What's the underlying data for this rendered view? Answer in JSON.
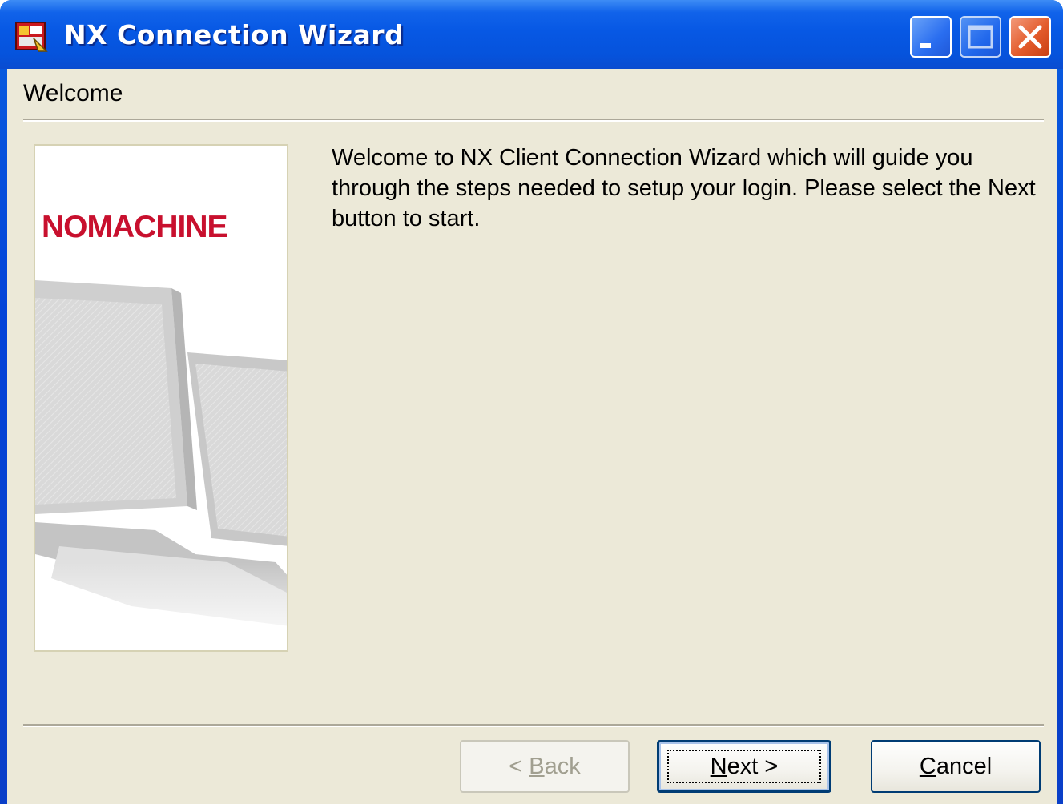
{
  "window": {
    "title": "NX Connection Wizard",
    "app_icon": "nx-app-icon",
    "controls": {
      "minimize_icon": "minimize-icon",
      "maximize_icon": "maximize-icon",
      "close_icon": "close-icon"
    }
  },
  "header": {
    "title": "Welcome"
  },
  "banner": {
    "logo_text": "NOMACHINE",
    "logo_color": "#c8102e"
  },
  "main": {
    "welcome_text": "Welcome to NX Client Connection Wizard which will guide you through the steps needed to setup your login. Please select the Next button to start."
  },
  "buttons": {
    "back": {
      "prefix": "< ",
      "mnemonic": "B",
      "rest": "ack",
      "enabled": false
    },
    "next": {
      "mnemonic": "N",
      "rest": "ext >",
      "default": true
    },
    "cancel": {
      "mnemonic": "C",
      "rest": "ancel"
    }
  },
  "colors": {
    "titlebar_blue": "#0653dc",
    "client_background": "#ece9d8",
    "close_button": "#e35b2c"
  }
}
